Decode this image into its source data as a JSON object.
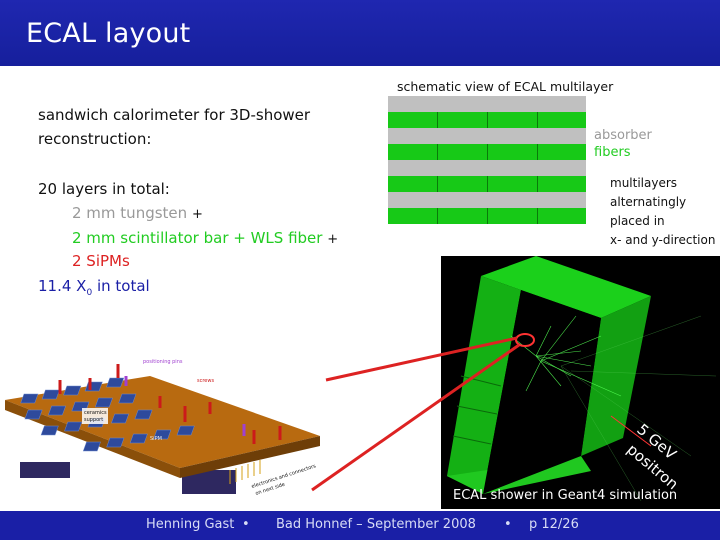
{
  "title": "ECAL layout",
  "bullets": {
    "intro_line1": "sandwich calorimeter for 3D-shower",
    "intro_line2": "reconstruction:",
    "layers_total": "20 layers in total:",
    "tungsten": "2 mm tungsten",
    "plus": "+",
    "scint": "2 mm scintillator bar + WLS fiber",
    "sipms": "2 SiPMs",
    "x0_prefix": "11.4 X",
    "x0_sub": "0",
    "x0_suffix": " in total"
  },
  "schematic": {
    "title": "schematic view of ECAL multilayer",
    "absorber": "absorber",
    "fibers": "fibers",
    "note1": "multilayers",
    "note2": "alternatingly",
    "note3": "placed in",
    "note4": "x- and y-direction"
  },
  "board_labels": {
    "positioning": "positioning pins",
    "screws": "screws",
    "ceramics1": "ceramics",
    "ceramics2": "support",
    "sipm": "SiPM",
    "electronics1": "electronics and connectors",
    "electronics2": "on next side"
  },
  "simulation": {
    "label1": "5 GeV",
    "label2": "positron",
    "caption": "ECAL shower in Geant4 simulation"
  },
  "footer": {
    "author": "Henning Gast",
    "sep1": "•",
    "venue": "Bad Honnef – September 2008",
    "sep2": "•",
    "page": "p 12/26"
  },
  "colors": {
    "header_blue": "#1a1fa6",
    "absorber_grey": "#c0c0c0",
    "fiber_green": "#17c917",
    "sipm_red": "#dd2222"
  }
}
